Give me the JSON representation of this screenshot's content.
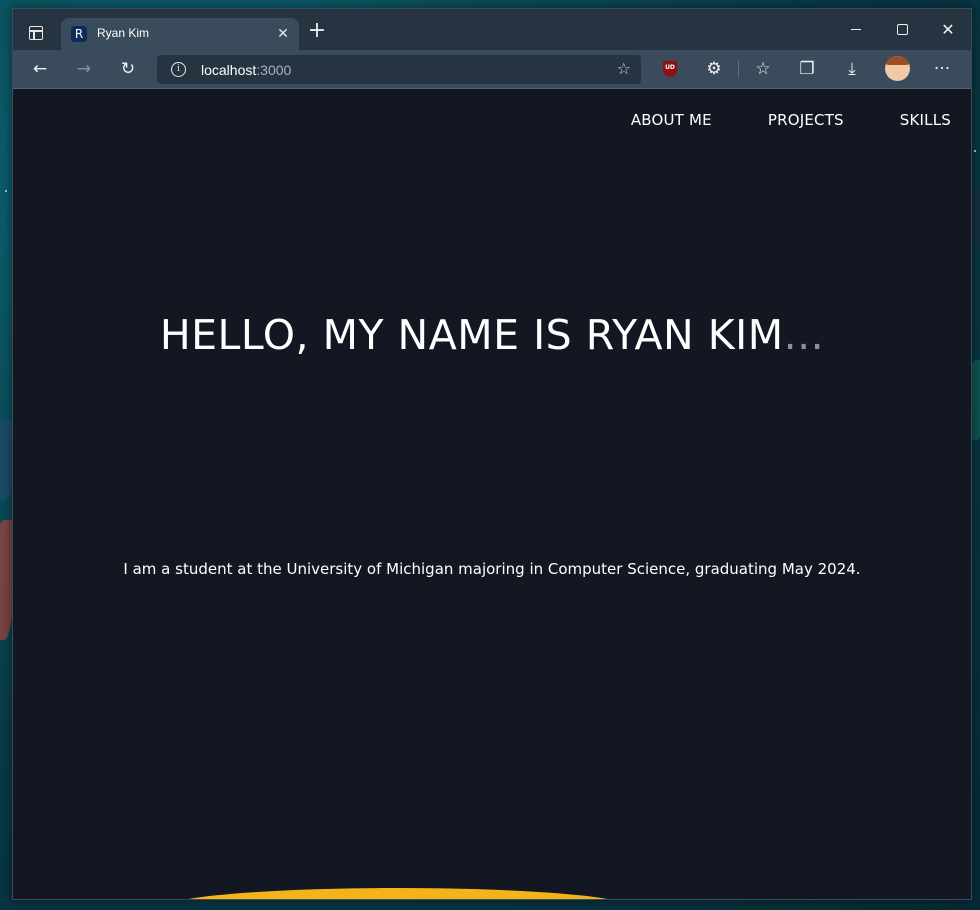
{
  "browser": {
    "tab": {
      "favicon_letter": "R",
      "title": "Ryan Kim",
      "close_glyph": "✕"
    },
    "new_tab_glyph": "+",
    "window_controls": {
      "close_glyph": "✕"
    },
    "address": {
      "host": "localhost",
      "port": ":3000"
    },
    "toolbar_icons": [
      "back-icon",
      "forward-icon",
      "refresh-icon",
      "info-icon",
      "add-favorite-icon",
      "ublock-icon",
      "extensions-icon",
      "favorites-icon",
      "collections-icon",
      "downloads-icon",
      "profile-avatar",
      "more-icon"
    ],
    "ublock_label": "UD",
    "more_glyph": "···"
  },
  "page": {
    "nav": [
      "ABOUT ME",
      "PROJECTS",
      "SKILLS"
    ],
    "hero": {
      "title": "HELLO, MY NAME IS RYAN KIM",
      "ellipsis": "...",
      "subtitle": "I am a student at the University of Michigan majoring in Computer Science, graduating May 2024."
    },
    "colors": {
      "background": "#131722",
      "text": "#ffffff",
      "accent": "#f4b21b"
    }
  }
}
